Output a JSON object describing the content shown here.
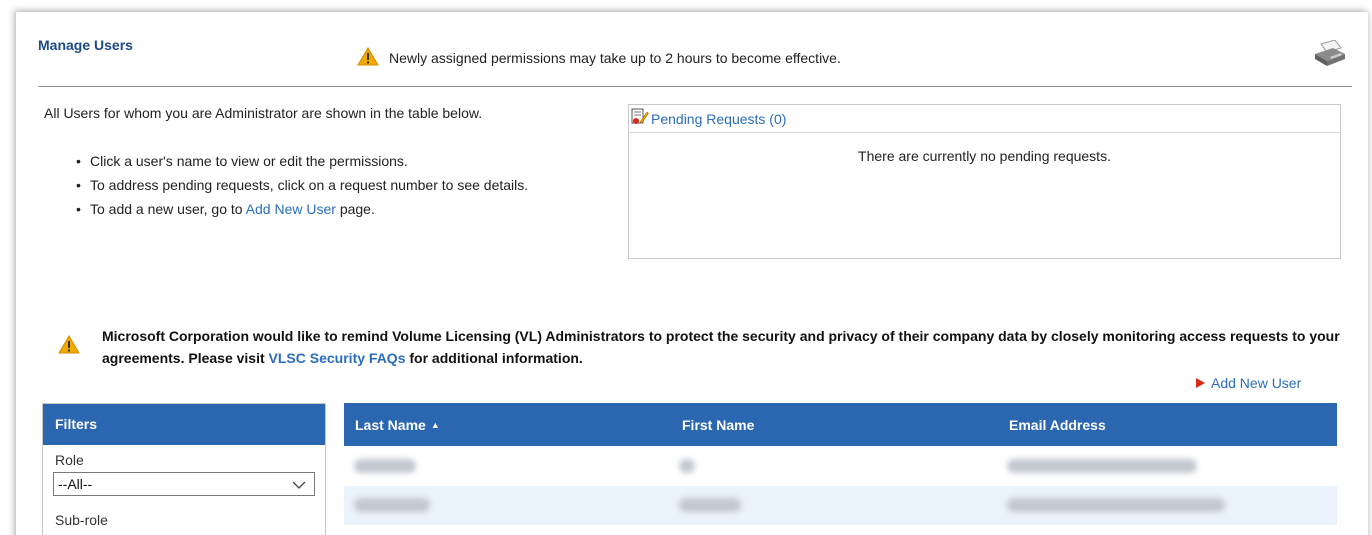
{
  "page": {
    "title": "Manage Users",
    "notice": "Newly assigned permissions may take up to 2 hours to become effective.",
    "print_icon": "printer-icon"
  },
  "intro": {
    "text": "All Users for whom you are Administrator are shown in the table below.",
    "bullet1": "Click a user's name to view or edit the permissions.",
    "bullet2": "To address pending requests, click on a request number to see details.",
    "bullet3_prefix": "To add a new user, go to ",
    "bullet3_link": "Add New User",
    "bullet3_suffix": " page."
  },
  "pending": {
    "title": "Pending Requests (0)",
    "message": "There are currently no pending requests."
  },
  "warning": {
    "text_prefix": "Microsoft Corporation would like to remind Volume Licensing (VL) Administrators to protect the security and privacy of their company data by closely monitoring access requests to your agreements. Please visit ",
    "link": "VLSC Security FAQs",
    "text_suffix": " for additional information."
  },
  "actions": {
    "add_new_user": "Add New User"
  },
  "filters": {
    "title": "Filters",
    "role_label": "Role",
    "role_value": "--All--",
    "subrole_label": "Sub-role"
  },
  "table": {
    "columns": [
      "Last Name",
      "First Name",
      "Email Address"
    ],
    "sort_indicator": "▲"
  },
  "colors": {
    "header_blue": "#2b66b1",
    "title_blue": "#1e4a86",
    "link_blue": "#2a6ebb",
    "warning_yellow": "#f2a900",
    "arrow_red": "#d62b16",
    "alt_row": "#eaf2fb"
  }
}
